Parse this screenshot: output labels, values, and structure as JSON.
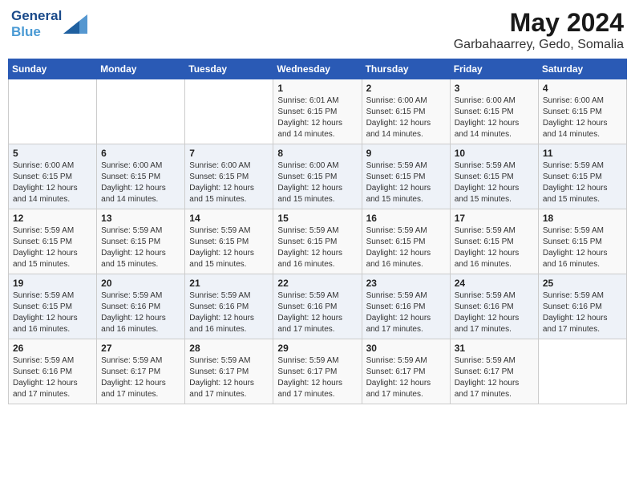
{
  "logo": {
    "line1": "General",
    "line2": "Blue"
  },
  "title": "May 2024",
  "subtitle": "Garbahaarrey, Gedo, Somalia",
  "days_of_week": [
    "Sunday",
    "Monday",
    "Tuesday",
    "Wednesday",
    "Thursday",
    "Friday",
    "Saturday"
  ],
  "weeks": [
    [
      {
        "day": "",
        "info": ""
      },
      {
        "day": "",
        "info": ""
      },
      {
        "day": "",
        "info": ""
      },
      {
        "day": "1",
        "info": "Sunrise: 6:01 AM\nSunset: 6:15 PM\nDaylight: 12 hours\nand 14 minutes."
      },
      {
        "day": "2",
        "info": "Sunrise: 6:00 AM\nSunset: 6:15 PM\nDaylight: 12 hours\nand 14 minutes."
      },
      {
        "day": "3",
        "info": "Sunrise: 6:00 AM\nSunset: 6:15 PM\nDaylight: 12 hours\nand 14 minutes."
      },
      {
        "day": "4",
        "info": "Sunrise: 6:00 AM\nSunset: 6:15 PM\nDaylight: 12 hours\nand 14 minutes."
      }
    ],
    [
      {
        "day": "5",
        "info": "Sunrise: 6:00 AM\nSunset: 6:15 PM\nDaylight: 12 hours\nand 14 minutes."
      },
      {
        "day": "6",
        "info": "Sunrise: 6:00 AM\nSunset: 6:15 PM\nDaylight: 12 hours\nand 14 minutes."
      },
      {
        "day": "7",
        "info": "Sunrise: 6:00 AM\nSunset: 6:15 PM\nDaylight: 12 hours\nand 15 minutes."
      },
      {
        "day": "8",
        "info": "Sunrise: 6:00 AM\nSunset: 6:15 PM\nDaylight: 12 hours\nand 15 minutes."
      },
      {
        "day": "9",
        "info": "Sunrise: 5:59 AM\nSunset: 6:15 PM\nDaylight: 12 hours\nand 15 minutes."
      },
      {
        "day": "10",
        "info": "Sunrise: 5:59 AM\nSunset: 6:15 PM\nDaylight: 12 hours\nand 15 minutes."
      },
      {
        "day": "11",
        "info": "Sunrise: 5:59 AM\nSunset: 6:15 PM\nDaylight: 12 hours\nand 15 minutes."
      }
    ],
    [
      {
        "day": "12",
        "info": "Sunrise: 5:59 AM\nSunset: 6:15 PM\nDaylight: 12 hours\nand 15 minutes."
      },
      {
        "day": "13",
        "info": "Sunrise: 5:59 AM\nSunset: 6:15 PM\nDaylight: 12 hours\nand 15 minutes."
      },
      {
        "day": "14",
        "info": "Sunrise: 5:59 AM\nSunset: 6:15 PM\nDaylight: 12 hours\nand 15 minutes."
      },
      {
        "day": "15",
        "info": "Sunrise: 5:59 AM\nSunset: 6:15 PM\nDaylight: 12 hours\nand 16 minutes."
      },
      {
        "day": "16",
        "info": "Sunrise: 5:59 AM\nSunset: 6:15 PM\nDaylight: 12 hours\nand 16 minutes."
      },
      {
        "day": "17",
        "info": "Sunrise: 5:59 AM\nSunset: 6:15 PM\nDaylight: 12 hours\nand 16 minutes."
      },
      {
        "day": "18",
        "info": "Sunrise: 5:59 AM\nSunset: 6:15 PM\nDaylight: 12 hours\nand 16 minutes."
      }
    ],
    [
      {
        "day": "19",
        "info": "Sunrise: 5:59 AM\nSunset: 6:15 PM\nDaylight: 12 hours\nand 16 minutes."
      },
      {
        "day": "20",
        "info": "Sunrise: 5:59 AM\nSunset: 6:16 PM\nDaylight: 12 hours\nand 16 minutes."
      },
      {
        "day": "21",
        "info": "Sunrise: 5:59 AM\nSunset: 6:16 PM\nDaylight: 12 hours\nand 16 minutes."
      },
      {
        "day": "22",
        "info": "Sunrise: 5:59 AM\nSunset: 6:16 PM\nDaylight: 12 hours\nand 17 minutes."
      },
      {
        "day": "23",
        "info": "Sunrise: 5:59 AM\nSunset: 6:16 PM\nDaylight: 12 hours\nand 17 minutes."
      },
      {
        "day": "24",
        "info": "Sunrise: 5:59 AM\nSunset: 6:16 PM\nDaylight: 12 hours\nand 17 minutes."
      },
      {
        "day": "25",
        "info": "Sunrise: 5:59 AM\nSunset: 6:16 PM\nDaylight: 12 hours\nand 17 minutes."
      }
    ],
    [
      {
        "day": "26",
        "info": "Sunrise: 5:59 AM\nSunset: 6:16 PM\nDaylight: 12 hours\nand 17 minutes."
      },
      {
        "day": "27",
        "info": "Sunrise: 5:59 AM\nSunset: 6:17 PM\nDaylight: 12 hours\nand 17 minutes."
      },
      {
        "day": "28",
        "info": "Sunrise: 5:59 AM\nSunset: 6:17 PM\nDaylight: 12 hours\nand 17 minutes."
      },
      {
        "day": "29",
        "info": "Sunrise: 5:59 AM\nSunset: 6:17 PM\nDaylight: 12 hours\nand 17 minutes."
      },
      {
        "day": "30",
        "info": "Sunrise: 5:59 AM\nSunset: 6:17 PM\nDaylight: 12 hours\nand 17 minutes."
      },
      {
        "day": "31",
        "info": "Sunrise: 5:59 AM\nSunset: 6:17 PM\nDaylight: 12 hours\nand 17 minutes."
      },
      {
        "day": "",
        "info": ""
      }
    ]
  ]
}
